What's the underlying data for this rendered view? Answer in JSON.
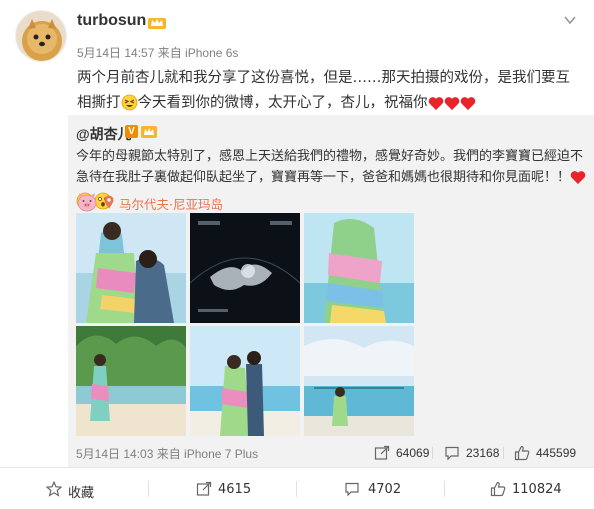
{
  "post": {
    "author": "turbosun",
    "meta": "5月14日 14:57 来自 iPhone 6s",
    "text_part1": "两个月前杏儿就和我分享了这份喜悦，但是……那天拍摄的戏份，是我们要互相撕打",
    "text_part2": "今天看到你的微博，太开心了，杏儿，祝福你"
  },
  "repost": {
    "author": "@胡杏儿",
    "badge_letter": "V",
    "text": "今年的母親節太特別了，感恩上天送給我們的禮物，感覺好奇妙。我們的李寶寶已經迫不急待在我肚子裏做起仰臥起坐了，寶寶再等一下，爸爸和媽媽也很期待和你見面呢！！",
    "location": "马尔代夫·尼亚玛岛",
    "time": "5月14日 14:03 来自 iPhone 7 Plus",
    "repost_count": "64069",
    "comment_count": "23168",
    "like_count": "445599"
  },
  "actions": {
    "favorite_label": "收藏",
    "repost_count": "4615",
    "comment_count": "4702",
    "like_count": "110824"
  },
  "icons": {
    "avatar": "pomeranian-dog-avatar",
    "vip": "vip-crown-badge",
    "more": "chevron-down-icon",
    "location": "location-pin-icon"
  },
  "colors": {
    "accent": "#eb7350",
    "meta_gray": "#808080",
    "repost_bg": "#f2f2f2",
    "heart_red": "#e8242b"
  }
}
